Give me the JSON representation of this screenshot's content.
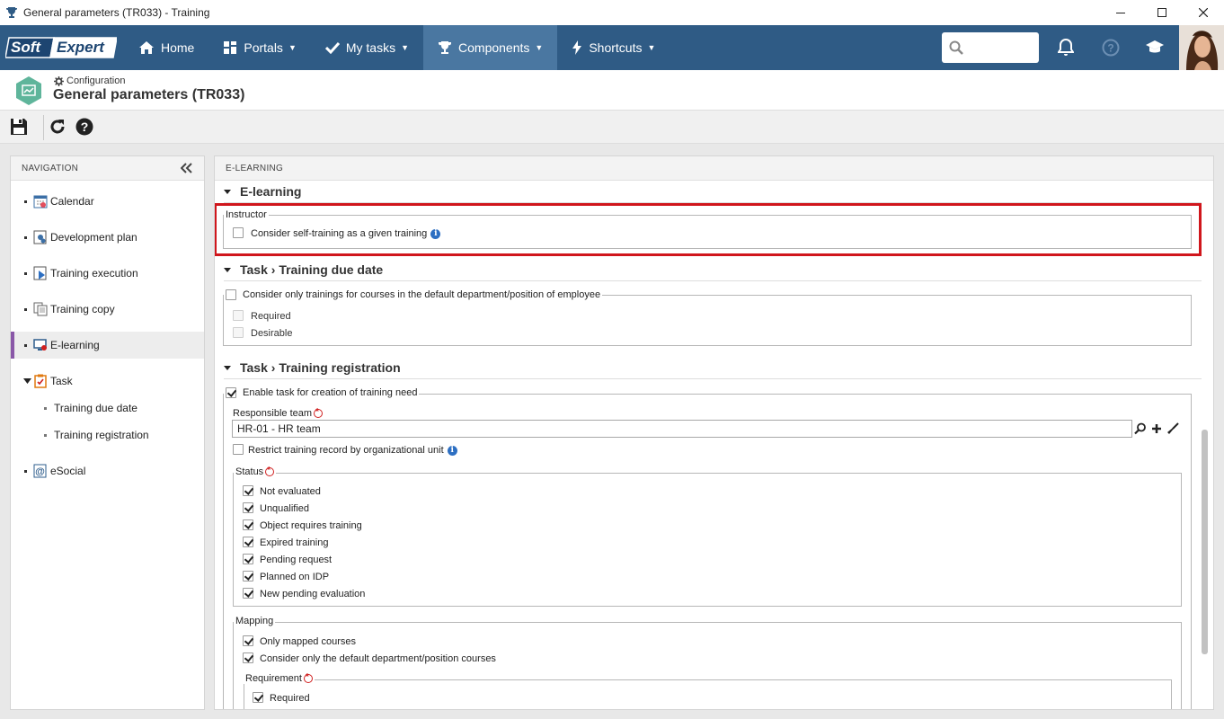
{
  "window": {
    "title": "General parameters (TR033) - Training"
  },
  "topnav": {
    "logo_part1": "Soft",
    "logo_part2": "Expert",
    "items": [
      {
        "label": "Home",
        "icon": "home-icon"
      },
      {
        "label": "Portals",
        "icon": "grid-icon"
      },
      {
        "label": "My tasks",
        "icon": "check-icon"
      },
      {
        "label": "Components",
        "icon": "trophy-icon"
      },
      {
        "label": "Shortcuts",
        "icon": "lightning-icon"
      }
    ],
    "search_placeholder": ""
  },
  "header": {
    "breadcrumb": "Configuration",
    "title": "General parameters (TR033)"
  },
  "navigation": {
    "heading": "NAVIGATION",
    "items": [
      {
        "label": "Calendar",
        "icon": "calendar-icon"
      },
      {
        "label": "Development plan",
        "icon": "development-plan-icon"
      },
      {
        "label": "Training execution",
        "icon": "training-execution-icon"
      },
      {
        "label": "Training copy",
        "icon": "copy-icon"
      },
      {
        "label": "E-learning",
        "icon": "e-learning-icon"
      },
      {
        "label": "Task",
        "icon": "task-icon"
      },
      {
        "label": "Training due date",
        "icon": ""
      },
      {
        "label": "Training registration",
        "icon": ""
      },
      {
        "label": "eSocial",
        "icon": "esocial-icon"
      }
    ]
  },
  "content": {
    "heading": "E-LEARNING",
    "elearning": {
      "section_title": "E-learning",
      "instructor_legend": "Instructor",
      "self_training_label": "Consider self-training as a given training",
      "self_training_checked": false
    },
    "due_date": {
      "section_title": "Task › Training due date",
      "only_default_label": "Consider only trainings for courses in the default department/position of employee",
      "required_label": "Required",
      "desirable_label": "Desirable"
    },
    "registration": {
      "section_title": "Task › Training registration",
      "enable_label": "Enable task for creation of training need",
      "responsible_team_label": "Responsible team",
      "responsible_team_value": "HR-01 - HR team",
      "restrict_label": "Restrict training record by organizational unit",
      "status_legend": "Status",
      "status_items": [
        "Not evaluated",
        "Unqualified",
        "Object requires training",
        "Expired training",
        "Pending request",
        "Planned on IDP",
        "New pending evaluation"
      ],
      "mapping_legend": "Mapping",
      "only_mapped_label": "Only mapped courses",
      "only_default_courses_label": "Consider only the default department/position courses",
      "requirement_legend": "Requirement",
      "requirement_required_label": "Required"
    }
  },
  "colors": {
    "nav_bar": "#2f5b85",
    "nav_active": "#4a77a1",
    "highlight_border": "#d0161c",
    "selected_accent": "#8a58a8"
  }
}
